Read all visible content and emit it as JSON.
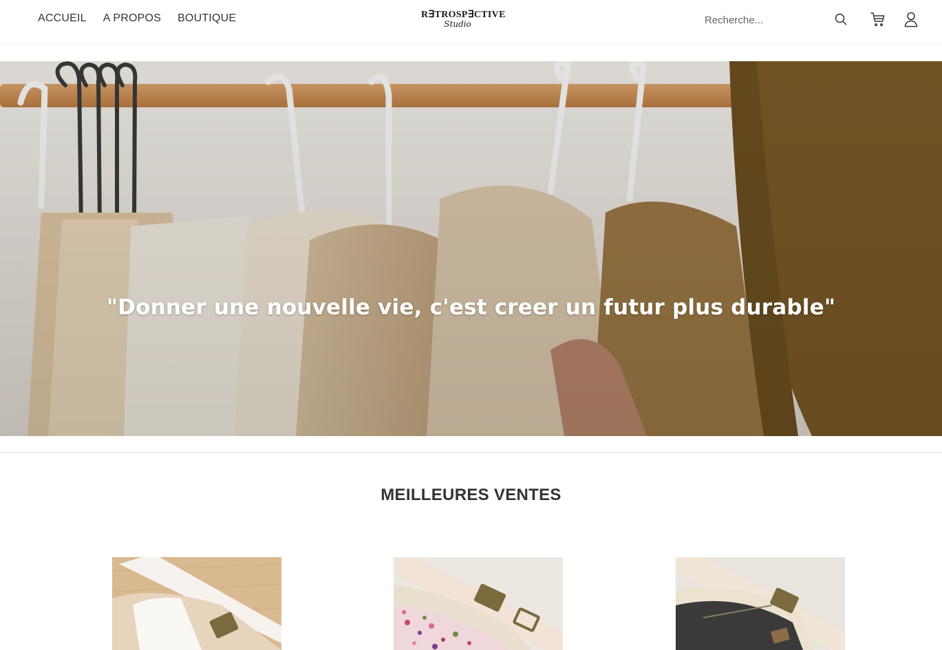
{
  "header": {
    "nav": [
      {
        "label": "ACCUEIL"
      },
      {
        "label": "A PROPOS"
      },
      {
        "label": "BOUTIQUE"
      }
    ],
    "logo": {
      "line1": "R∃TROSP∃CTIVE",
      "line2": "Studio"
    },
    "search": {
      "placeholder": "Recherche..."
    },
    "icons": [
      "search-icon",
      "cart-icon",
      "user-icon"
    ]
  },
  "hero": {
    "quote": "\"Donner une nouvelle vie, c'est creer un futur plus durable\""
  },
  "best_sellers": {
    "title": "MEILLEURES VENTES",
    "products": [
      {
        "name": "beige-fanny-pack"
      },
      {
        "name": "floral-fanny-pack"
      },
      {
        "name": "black-fanny-pack"
      }
    ]
  },
  "colors": {
    "text": "#333333",
    "hero_text": "#ffffff",
    "brown_hat": "#7a5a26"
  }
}
